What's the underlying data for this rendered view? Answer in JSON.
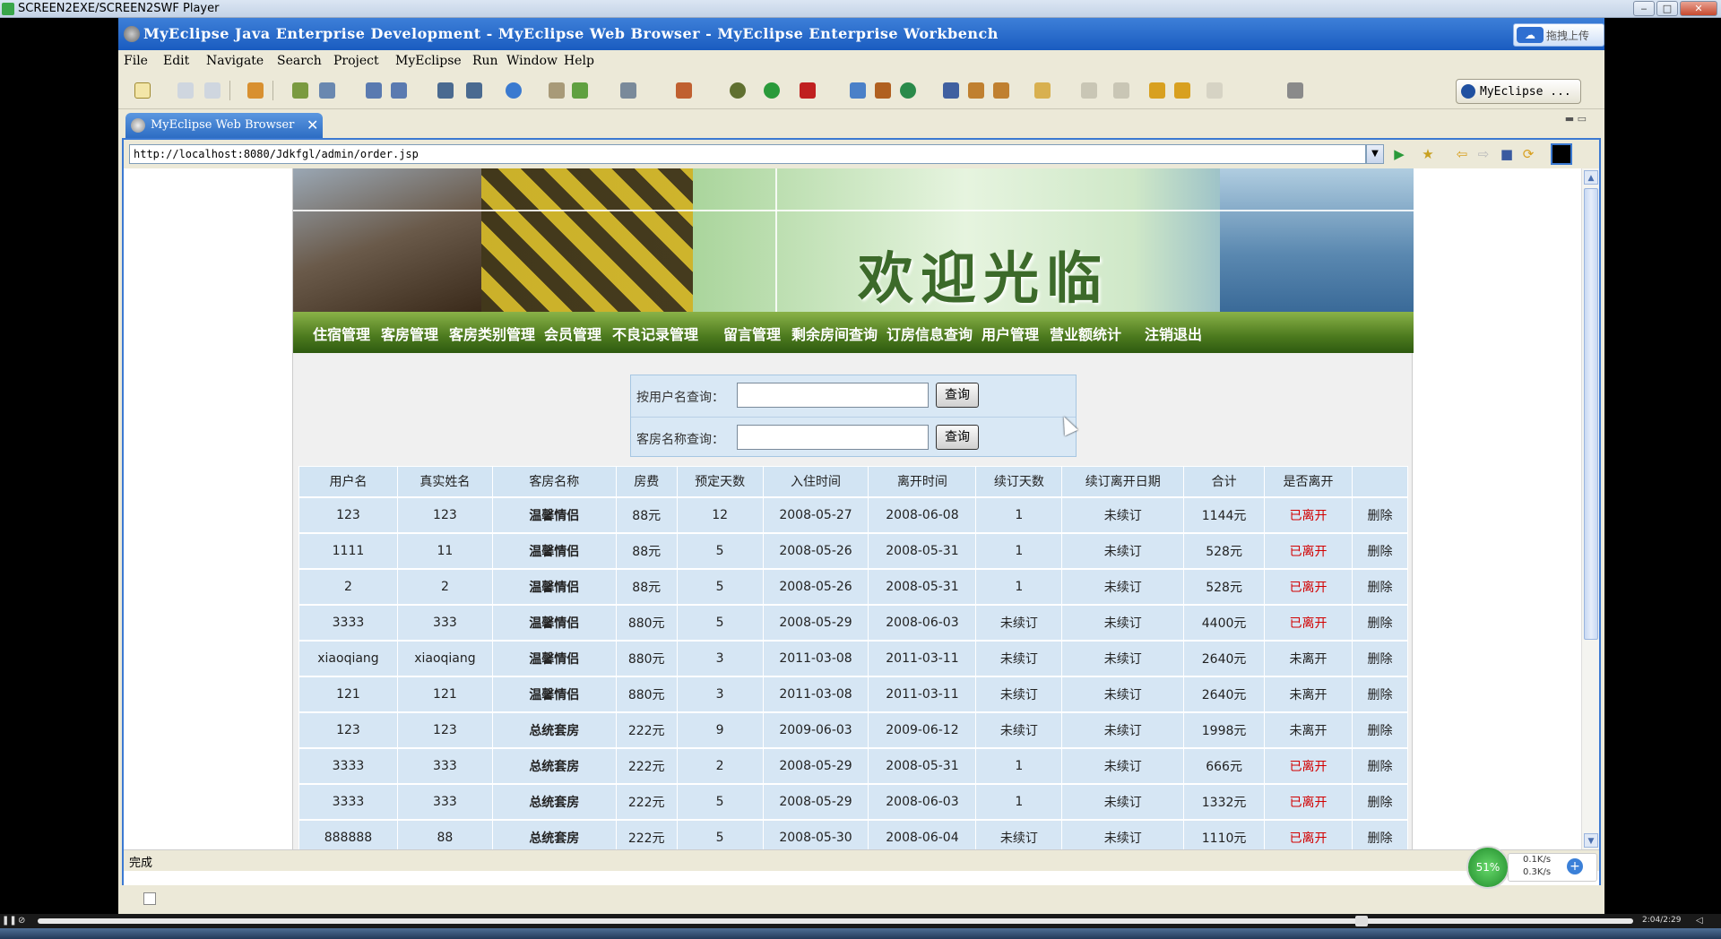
{
  "player": {
    "title": "SCREEN2EXE/SCREEN2SWF Player",
    "time": "2:04/2:29"
  },
  "ide": {
    "title": "MyEclipse Java Enterprise Development - MyEclipse Web Browser - MyEclipse Enterprise Workbench",
    "upload_label": "拖拽上传",
    "menu": [
      "File",
      "Edit",
      "Navigate",
      "Search",
      "Project",
      "MyEclipse",
      "Run",
      "Window",
      "Help"
    ],
    "perspective": "MyEclipse ...",
    "tab_label": "MyEclipse Web Browser",
    "url": "http://localhost:8080/Jdkfgl/admin/order.jsp",
    "status": "完成"
  },
  "site": {
    "welcome": "欢迎光临",
    "nav": [
      "住宿管理",
      "客房管理",
      "客房类别管理",
      "会员管理",
      "不良记录管理",
      "留言管理",
      "剩余房间查询",
      "订房信息查询",
      "用户管理",
      "营业额统计",
      "注销退出"
    ],
    "search": {
      "by_user_label": "按用户名查询：",
      "by_room_label": "客房名称查询：",
      "button": "查询"
    },
    "table": {
      "headers": [
        "用户名",
        "真实姓名",
        "客房名称",
        "房费",
        "预定天数",
        "入住时间",
        "离开时间",
        "续订天数",
        "续订离开日期",
        "合计",
        "是否离开",
        ""
      ],
      "delete_label": "删除",
      "rows": [
        {
          "user": "123",
          "name": "123",
          "room": "温馨情侣",
          "fee": "88元",
          "days": "12",
          "in": "2008-05-27",
          "out": "2008-06-08",
          "renew_days": "1",
          "renew_date": "未续订",
          "total": "1144元",
          "left": "已离开",
          "left_red": true
        },
        {
          "user": "1111",
          "name": "11",
          "room": "温馨情侣",
          "fee": "88元",
          "days": "5",
          "in": "2008-05-26",
          "out": "2008-05-31",
          "renew_days": "1",
          "renew_date": "未续订",
          "total": "528元",
          "left": "已离开",
          "left_red": true
        },
        {
          "user": "2",
          "name": "2",
          "room": "温馨情侣",
          "fee": "88元",
          "days": "5",
          "in": "2008-05-26",
          "out": "2008-05-31",
          "renew_days": "1",
          "renew_date": "未续订",
          "total": "528元",
          "left": "已离开",
          "left_red": true
        },
        {
          "user": "3333",
          "name": "333",
          "room": "温馨情侣",
          "fee": "880元",
          "days": "5",
          "in": "2008-05-29",
          "out": "2008-06-03",
          "renew_days": "未续订",
          "renew_date": "未续订",
          "total": "4400元",
          "left": "已离开",
          "left_red": true
        },
        {
          "user": "xiaoqiang",
          "name": "xiaoqiang",
          "room": "温馨情侣",
          "fee": "880元",
          "days": "3",
          "in": "2011-03-08",
          "out": "2011-03-11",
          "renew_days": "未续订",
          "renew_date": "未续订",
          "total": "2640元",
          "left": "未离开",
          "left_red": false
        },
        {
          "user": "121",
          "name": "121",
          "room": "温馨情侣",
          "fee": "880元",
          "days": "3",
          "in": "2011-03-08",
          "out": "2011-03-11",
          "renew_days": "未续订",
          "renew_date": "未续订",
          "total": "2640元",
          "left": "未离开",
          "left_red": false
        },
        {
          "user": "123",
          "name": "123",
          "room": "总统套房",
          "fee": "222元",
          "days": "9",
          "in": "2009-06-03",
          "out": "2009-06-12",
          "renew_days": "未续订",
          "renew_date": "未续订",
          "total": "1998元",
          "left": "未离开",
          "left_red": false
        },
        {
          "user": "3333",
          "name": "333",
          "room": "总统套房",
          "fee": "222元",
          "days": "2",
          "in": "2008-05-29",
          "out": "2008-05-31",
          "renew_days": "1",
          "renew_date": "未续订",
          "total": "666元",
          "left": "已离开",
          "left_red": true
        },
        {
          "user": "3333",
          "name": "333",
          "room": "总统套房",
          "fee": "222元",
          "days": "5",
          "in": "2008-05-29",
          "out": "2008-06-03",
          "renew_days": "1",
          "renew_date": "未续订",
          "total": "1332元",
          "left": "已离开",
          "left_red": true
        },
        {
          "user": "888888",
          "name": "88",
          "room": "总统套房",
          "fee": "222元",
          "days": "5",
          "in": "2008-05-30",
          "out": "2008-06-04",
          "renew_days": "未续订",
          "renew_date": "未续订",
          "total": "1110元",
          "left": "已离开",
          "left_red": true
        }
      ]
    }
  },
  "netmeter": {
    "percent": "51%",
    "up": "0.1K/s",
    "down": "0.3K/s"
  },
  "colors": {
    "ide_title": "#1a5cc0",
    "nav_green": "#4c7a1e",
    "table_cell": "#d6e6f4",
    "left_red": "#d20000"
  }
}
